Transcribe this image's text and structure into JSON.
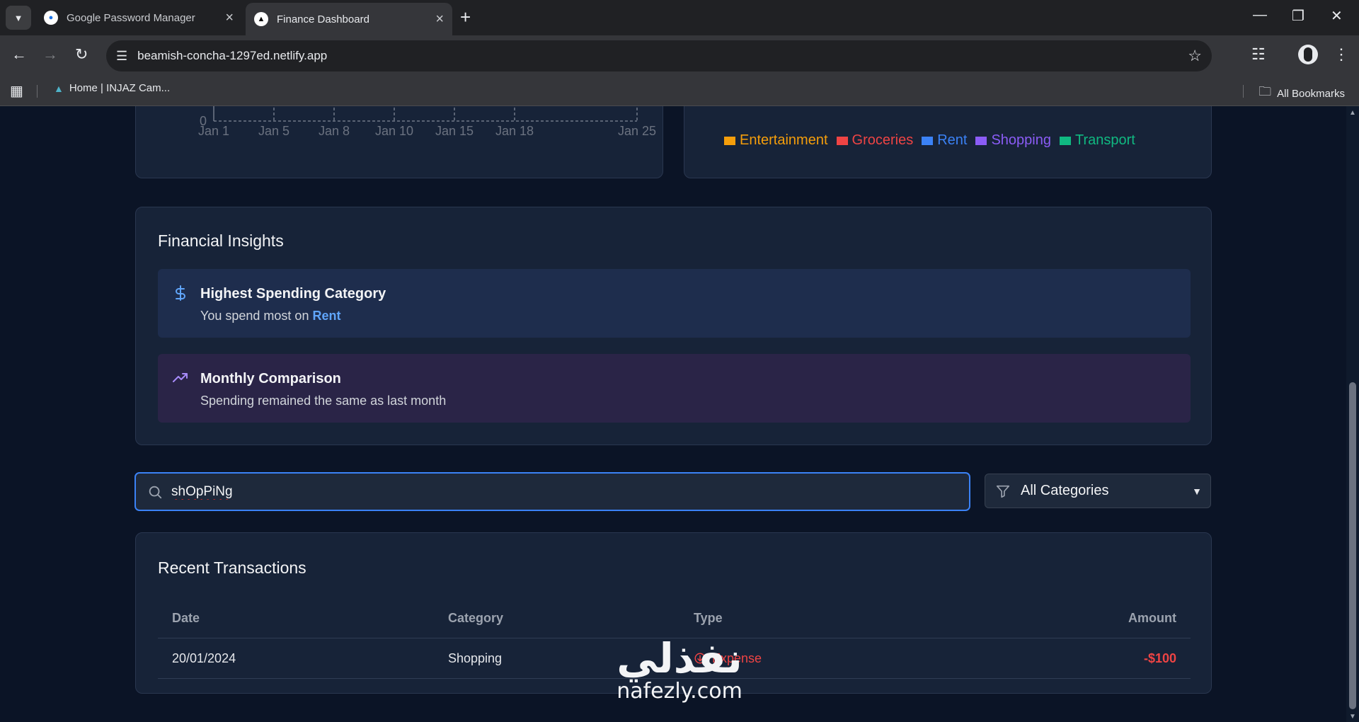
{
  "browser": {
    "tabs": [
      {
        "title": "Google Password Manager",
        "active": false
      },
      {
        "title": "Finance Dashboard",
        "active": true
      }
    ],
    "url": "beamish-concha-1297ed.netlify.app",
    "bookmarks": [
      {
        "label": "Home | INJAZ Cam..."
      }
    ],
    "all_bookmarks": "All Bookmarks"
  },
  "chart_data": {
    "type": "line",
    "x_tick_labels": [
      "Jan 1",
      "Jan 5",
      "Jan 8",
      "Jan 10",
      "Jan 15",
      "Jan 18",
      "Jan 25"
    ],
    "y_tick_labels": [
      "0"
    ]
  },
  "pie_legend": [
    {
      "label": "Entertainment",
      "color": "#f59e0b"
    },
    {
      "label": "Groceries",
      "color": "#ef4444"
    },
    {
      "label": "Rent",
      "color": "#3b82f6"
    },
    {
      "label": "Shopping",
      "color": "#8b5cf6"
    },
    {
      "label": "Transport",
      "color": "#10b981"
    }
  ],
  "insights": {
    "title": "Financial Insights",
    "highest": {
      "heading": "Highest Spending Category",
      "prefix": "You spend most on ",
      "value": "Rent"
    },
    "monthly": {
      "heading": "Monthly Comparison",
      "text": "Spending remained the same as last month"
    }
  },
  "search": {
    "value": "shOpPiNg"
  },
  "filter": {
    "selected": "All Categories"
  },
  "transactions": {
    "title": "Recent Transactions",
    "columns": [
      "Date",
      "Category",
      "Type",
      "Amount"
    ],
    "rows": [
      {
        "date": "20/01/2024",
        "category": "Shopping",
        "type": "Expense",
        "amount": "-$100"
      }
    ]
  },
  "watermark": {
    "arabic": "نفذلي",
    "latin": "nafezly.com"
  },
  "colors": {
    "accent": "#3b82f6",
    "expense": "#ef4444",
    "background": "#0b1426",
    "card": "#172338"
  }
}
